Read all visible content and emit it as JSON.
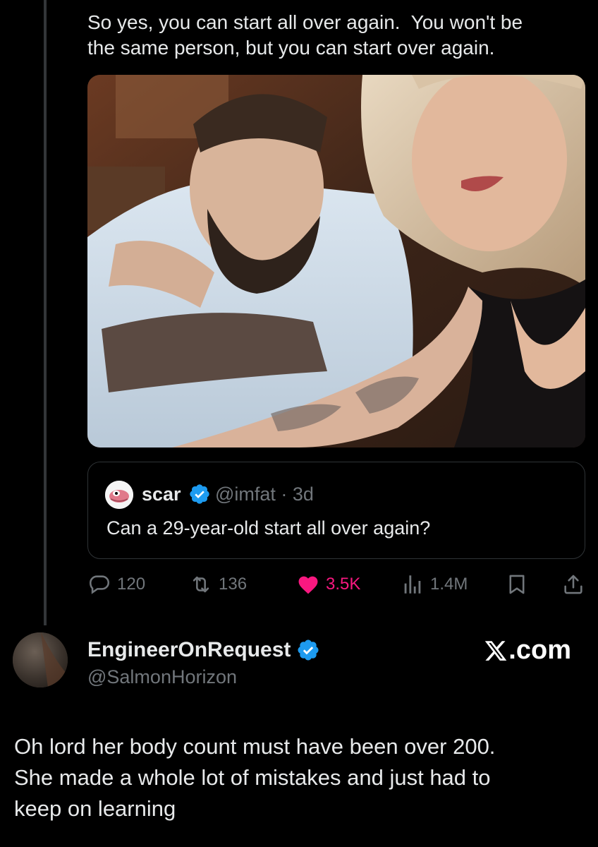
{
  "tweet": {
    "text": "So yes, you can start all over again.  You won't be\nthe same person, but you can start over again."
  },
  "quoted_tweet": {
    "name": "scar",
    "handle_time": "@imfat · 3d",
    "text": "Can a 29-year-old start all over again?"
  },
  "actions": {
    "replies": "120",
    "reposts": "136",
    "likes": "3.5K",
    "views": "1.4M"
  },
  "reply": {
    "name": "EngineerOnRequest",
    "handle": "@SalmonHorizon",
    "brand": ".com",
    "text": "Oh lord her body count must have been over 200.\nShe made a whole lot of mistakes and just had to\nkeep on learning"
  },
  "colors": {
    "background": "#000000",
    "text": "#e7e9ea",
    "muted": "#71767b",
    "verified": "#1d9bf0",
    "like": "#f91880",
    "border": "#2f3336"
  }
}
